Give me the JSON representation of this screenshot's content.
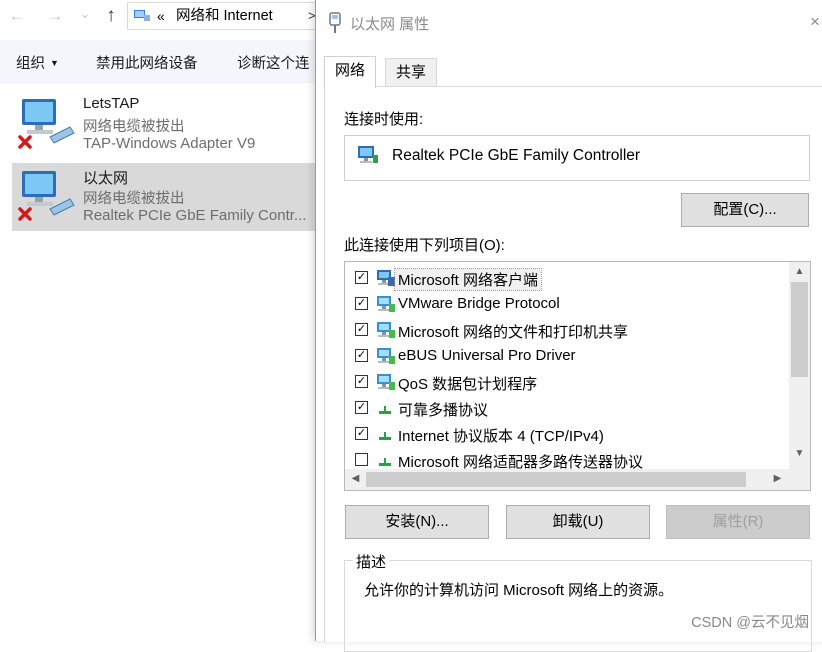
{
  "explorer": {
    "nav": {
      "back_glyph": "←",
      "forward_glyph": "→",
      "history_glyph": "⌄",
      "up_glyph": "↑"
    },
    "address": {
      "chevron": "«",
      "text": "网络和 Internet",
      "separator": ">"
    },
    "commands": {
      "organize": "组织",
      "disable_device": "禁用此网络设备",
      "diagnose": "诊断这个连"
    },
    "connections": [
      {
        "name": "LetsTAP",
        "status": "网络电缆被拔出",
        "device": "TAP-Windows Adapter V9",
        "selected": false
      },
      {
        "name": "以太网",
        "status": "网络电缆被拔出",
        "device": "Realtek PCIe GbE Family Contr...",
        "selected": true
      }
    ]
  },
  "dialog": {
    "title": "以太网 属性",
    "close_glyph": "×",
    "tabs": [
      {
        "label": "网络",
        "active": true
      },
      {
        "label": "共享",
        "active": false
      }
    ],
    "connect_using_label": "连接时使用:",
    "adapter_name": "Realtek PCIe GbE Family Controller",
    "configure_button": "配置(C)...",
    "items_label": "此连接使用下列项目(O):",
    "items": [
      {
        "label": "Microsoft 网络客户端",
        "checked": true,
        "icon": "network-client-icon"
      },
      {
        "label": "VMware Bridge Protocol",
        "checked": true,
        "icon": "network-service-icon"
      },
      {
        "label": "Microsoft 网络的文件和打印机共享",
        "checked": true,
        "icon": "network-service-icon"
      },
      {
        "label": "eBUS Universal Pro Driver",
        "checked": true,
        "icon": "network-service-icon"
      },
      {
        "label": "QoS 数据包计划程序",
        "checked": true,
        "icon": "network-service-icon"
      },
      {
        "label": "可靠多播协议",
        "checked": true,
        "icon": "protocol-icon"
      },
      {
        "label": "Internet 协议版本 4 (TCP/IPv4)",
        "checked": true,
        "icon": "protocol-icon"
      },
      {
        "label": "Microsoft 网络适配器多路传送器协议",
        "checked": false,
        "icon": "protocol-icon"
      }
    ],
    "checkmark": "✓",
    "buttons": {
      "install": "安装(N)...",
      "uninstall": "卸载(U)",
      "properties": "属性(R)"
    },
    "description": {
      "title": "描述",
      "text": "允许你的计算机访问 Microsoft 网络上的资源。"
    }
  },
  "watermark": "CSDN @云不见烟",
  "colors": {
    "selection_bg": "#d9d9d9",
    "button_bg": "#e1e1e1",
    "disabled_text": "#a0a0a0",
    "error_red": "#d11a1a"
  }
}
